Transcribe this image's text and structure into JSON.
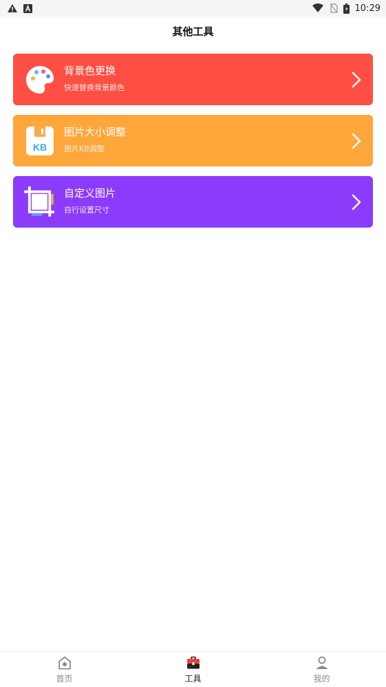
{
  "status_bar": {
    "time": "10:29",
    "icons": [
      "warning-icon",
      "a-badge-icon",
      "wifi-icon",
      "no-sim-icon",
      "battery-icon"
    ]
  },
  "header": {
    "title": "其他工具"
  },
  "tools": [
    {
      "title": "背景色更换",
      "subtitle": "快速替换背景颜色",
      "color": "#ff4f45",
      "icon": "palette-icon"
    },
    {
      "title": "图片大小调整",
      "subtitle": "图片KB调整",
      "color": "#ffa73b",
      "icon": "kb-file-icon"
    },
    {
      "title": "自定义图片",
      "subtitle": "自行设置尺寸",
      "color": "#8b3cfb",
      "icon": "crop-frame-icon"
    }
  ],
  "bottom_nav": {
    "items": [
      {
        "label": "首页",
        "icon": "home-icon",
        "active": false
      },
      {
        "label": "工具",
        "icon": "toolbox-icon",
        "active": true
      },
      {
        "label": "我的",
        "icon": "user-icon",
        "active": false
      }
    ]
  },
  "colors": {
    "accent_red": "#ff4f45",
    "accent_orange": "#ffa73b",
    "accent_purple": "#8b3cfb"
  },
  "kb_icon_text": "KB"
}
